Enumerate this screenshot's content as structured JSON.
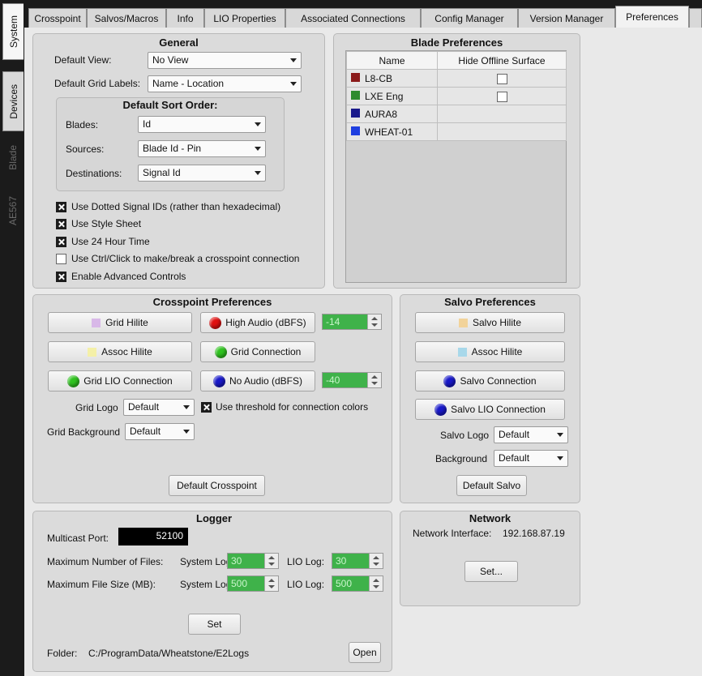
{
  "sidebar": {
    "tabs": [
      {
        "label": "System"
      },
      {
        "label": "Devices"
      },
      {
        "label": "Blade"
      },
      {
        "label": "AE567"
      }
    ]
  },
  "tabs": [
    {
      "label": "Crosspoint"
    },
    {
      "label": "Salvos/Macros"
    },
    {
      "label": "Info"
    },
    {
      "label": "LIO Properties"
    },
    {
      "label": "Associated Connections"
    },
    {
      "label": "Config Manager"
    },
    {
      "label": "Version Manager"
    },
    {
      "label": "Preferences"
    }
  ],
  "general": {
    "title": "General",
    "default_view_label": "Default View:",
    "default_view_value": "No View",
    "grid_labels_label": "Default Grid Labels:",
    "grid_labels_value": "Name - Location",
    "sort_order": {
      "title": "Default Sort Order:",
      "blades_label": "Blades:",
      "blades_value": "Id",
      "sources_label": "Sources:",
      "sources_value": "Blade Id - Pin",
      "destinations_label": "Destinations:",
      "destinations_value": "Signal Id"
    },
    "options": [
      {
        "label": "Use Dotted Signal IDs (rather than hexadecimal)",
        "checked": true
      },
      {
        "label": "Use Style Sheet",
        "checked": true
      },
      {
        "label": "Use 24 Hour Time",
        "checked": true
      },
      {
        "label": "Use Ctrl/Click to make/break a crosspoint connection",
        "checked": false
      },
      {
        "label": "Enable Advanced Controls",
        "checked": true
      }
    ]
  },
  "blade_prefs": {
    "title": "Blade Preferences",
    "col_name": "Name",
    "col_hide": "Hide Offline Surface",
    "rows": [
      {
        "name": "L8-CB",
        "color": "#8b1a1a",
        "checkbox": true
      },
      {
        "name": "LXE Eng",
        "color": "#2e8b2e",
        "checkbox": true
      },
      {
        "name": "AURA8",
        "color": "#1a1a8b",
        "checkbox": false
      },
      {
        "name": "WHEAT-01",
        "color": "#1f3fe0",
        "checkbox": false
      }
    ]
  },
  "crosspoint": {
    "title": "Crosspoint Preferences",
    "grid_hilite": "Grid Hilite",
    "grid_hilite_color": "#d8b8e8",
    "high_audio": "High Audio (dBFS)",
    "high_audio_value": "-14",
    "assoc_hilite": "Assoc Hilite",
    "assoc_hilite_color": "#f4f0a8",
    "grid_connection": "Grid Connection",
    "grid_lio_connection": "Grid LIO Connection",
    "no_audio": "No Audio (dBFS)",
    "no_audio_value": "-40",
    "grid_logo_label": "Grid Logo",
    "grid_logo_value": "Default",
    "threshold_label": "Use threshold for connection colors",
    "threshold_checked": true,
    "grid_bg_label": "Grid Background",
    "grid_bg_value": "Default",
    "default_btn": "Default Crosspoint"
  },
  "salvo": {
    "title": "Salvo Preferences",
    "salvo_hilite": "Salvo Hilite",
    "salvo_hilite_color": "#f2d39a",
    "assoc_hilite": "Assoc Hilite",
    "assoc_hilite_color": "#a8d8ea",
    "salvo_connection": "Salvo Connection",
    "salvo_lio_connection": "Salvo LIO Connection",
    "logo_label": "Salvo Logo",
    "logo_value": "Default",
    "bg_label": "Background",
    "bg_value": "Default",
    "default_btn": "Default Salvo"
  },
  "logger": {
    "title": "Logger",
    "multicast_label": "Multicast Port:",
    "multicast_value": "52100",
    "max_files_label": "Maximum Number of Files:",
    "max_size_label": "Maximum File Size (MB):",
    "system_log_label": "System Log:",
    "lio_log_label": "LIO Log:",
    "files_system": "30",
    "files_lio": "30",
    "size_system": "500",
    "size_lio": "500",
    "set_btn": "Set",
    "folder_label": "Folder:",
    "folder_value": "C:/ProgramData/Wheatstone/E2Logs",
    "open_btn": "Open"
  },
  "network": {
    "title": "Network",
    "interface_label": "Network Interface:",
    "interface_value": "192.168.87.19",
    "set_btn": "Set..."
  }
}
